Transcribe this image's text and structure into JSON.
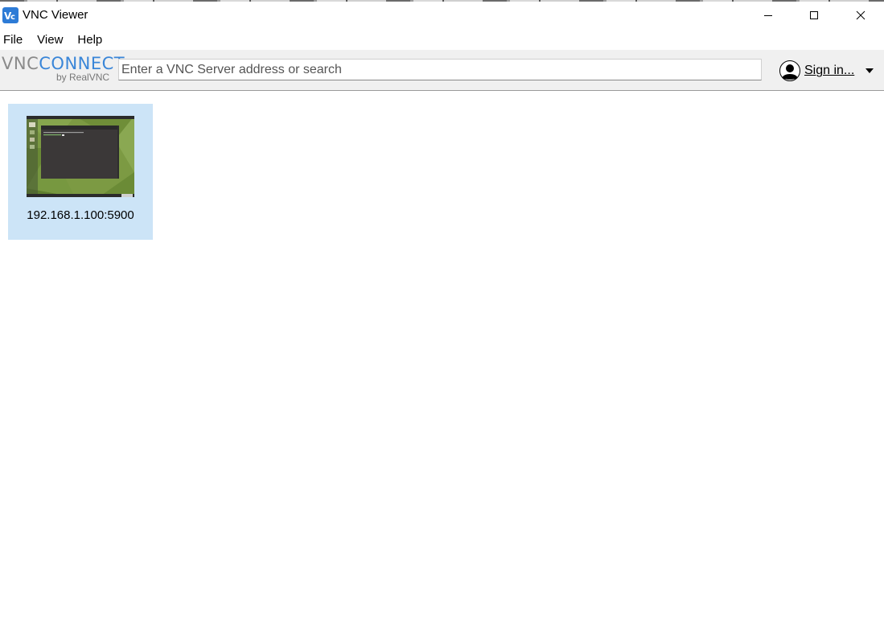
{
  "window": {
    "title": "VNC Viewer",
    "icon": "vnc-app-icon"
  },
  "menu": {
    "items": [
      "File",
      "View",
      "Help"
    ]
  },
  "toolbar": {
    "logo_primary_vnc": "VNC",
    "logo_primary_connect": "CONNECT",
    "logo_secondary": "by RealVNC",
    "search_placeholder": "Enter a VNC Server address or search",
    "search_value": "",
    "signin_label": "Sign in..."
  },
  "connections": [
    {
      "label": "192.168.1.100:5900",
      "selected": true,
      "thumbnail": "ubuntu-desktop-terminal-thumbnail"
    }
  ],
  "colors": {
    "accent": "#3a86d8",
    "selection": "#cce4f7",
    "toolbar_bg": "#f0f0f0"
  }
}
